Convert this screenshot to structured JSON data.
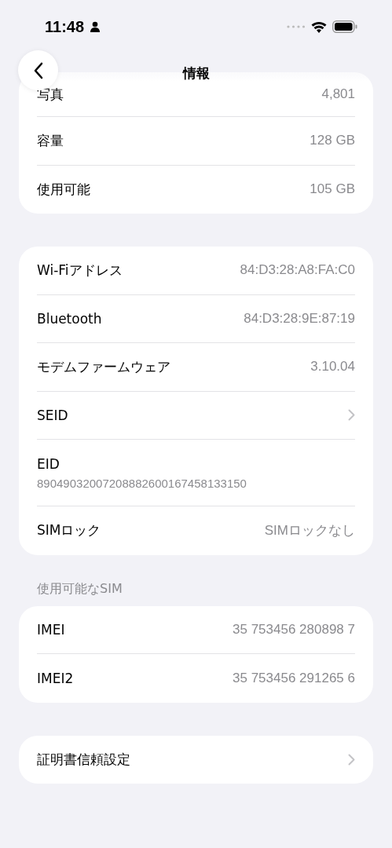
{
  "status_bar": {
    "time": "11:48"
  },
  "nav": {
    "title": "情報"
  },
  "sections": [
    {
      "rows": [
        {
          "kind": "value",
          "label": "写真",
          "value": "4,801"
        },
        {
          "kind": "value",
          "label": "容量",
          "value": "128 GB"
        },
        {
          "kind": "value",
          "label": "使用可能",
          "value": "105 GB"
        }
      ]
    },
    {
      "rows": [
        {
          "kind": "value",
          "label": "Wi-Fiアドレス",
          "value": "84:D3:28:A8:FA:C0"
        },
        {
          "kind": "value",
          "label": "Bluetooth",
          "value": "84:D3:28:9E:87:19"
        },
        {
          "kind": "value",
          "label": "モデムファームウェア",
          "value": "3.10.04"
        },
        {
          "kind": "link",
          "label": "SEID"
        },
        {
          "kind": "stacked",
          "label": "EID",
          "value": "89049032007208882600167458133150"
        },
        {
          "kind": "value",
          "label": "SIMロック",
          "value": "SIMロックなし"
        }
      ]
    },
    {
      "header": "使用可能なSIM",
      "rows": [
        {
          "kind": "value",
          "label": "IMEI",
          "value": "35 753456 280898 7"
        },
        {
          "kind": "value",
          "label": "IMEI2",
          "value": "35 753456 291265 6"
        }
      ]
    },
    {
      "rows": [
        {
          "kind": "link",
          "label": "証明書信頼設定"
        }
      ]
    }
  ]
}
